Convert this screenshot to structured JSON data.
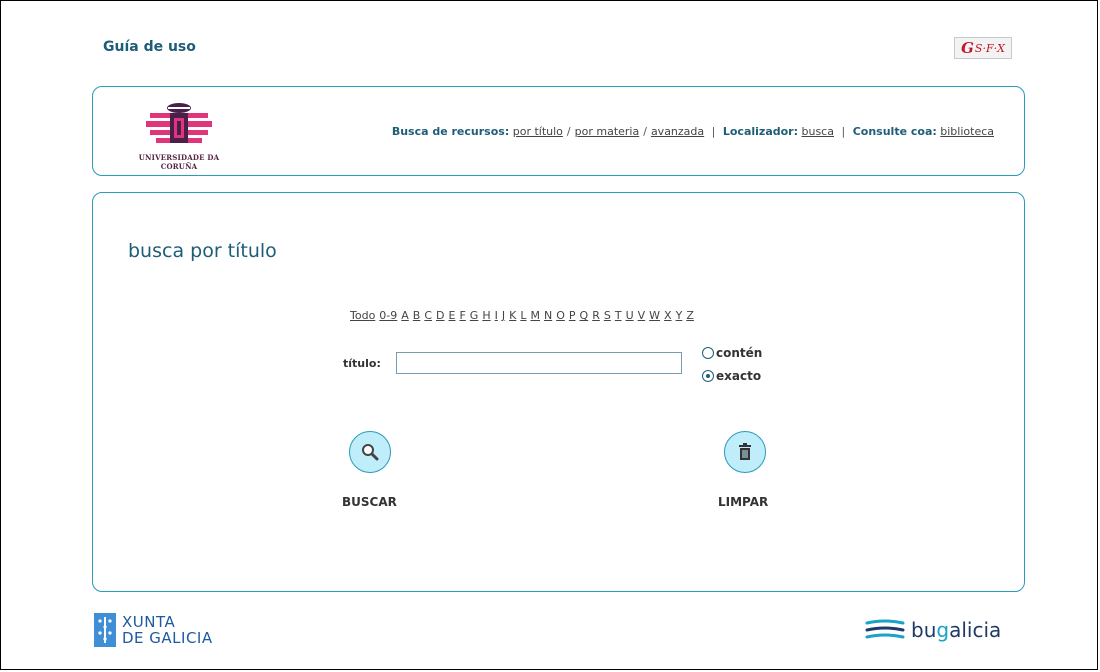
{
  "header": {
    "guide_link": "Guía de uso",
    "sfx_badge": {
      "glyph": "G",
      "text": "S·F·X"
    }
  },
  "institution": {
    "logo_caption": "UNIVERSIDADE DA CORUÑA",
    "logo_colors": {
      "primary": "#e0357b",
      "secondary": "#4a1f4a"
    }
  },
  "nav": {
    "resources_label": "Busca de recursos:",
    "resources_links": [
      "por título",
      "por materia",
      "avanzada"
    ],
    "locator_label": "Localizador:",
    "locator_link": "busca",
    "consult_label": "Consulte coa:",
    "consult_link": "biblioteca"
  },
  "search": {
    "title": "busca por título",
    "alphabet": [
      "Todo",
      "0-9",
      "A",
      "B",
      "C",
      "D",
      "E",
      "F",
      "G",
      "H",
      "I",
      "J",
      "K",
      "L",
      "M",
      "N",
      "O",
      "P",
      "Q",
      "R",
      "S",
      "T",
      "U",
      "V",
      "W",
      "X",
      "Y",
      "Z"
    ],
    "field_label": "título:",
    "field_value": "",
    "match_options": [
      {
        "label": "contén",
        "selected": false
      },
      {
        "label": "exacto",
        "selected": true
      }
    ],
    "search_button": "BUSCAR",
    "clear_button": "LIMPAR"
  },
  "footer": {
    "xunta_line1": "XUNTA",
    "xunta_line2": "DE GALICIA",
    "bugalicia_prefix": "bu",
    "bugalicia_highlight": "g",
    "bugalicia_suffix": "alicia"
  },
  "colors": {
    "accent": "#2a9bb8",
    "heading": "#1e5d78",
    "button_fill": "#bfeefa",
    "xunta_blue": "#3f8fd6"
  }
}
